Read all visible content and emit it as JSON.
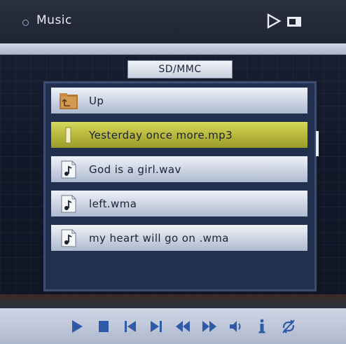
{
  "header": {
    "title": "Music"
  },
  "source": {
    "label": "SD/MMC"
  },
  "files": [
    {
      "name": "Up",
      "kind": "folder",
      "selected": false
    },
    {
      "name": "Yesterday once more.mp3",
      "kind": "audio",
      "selected": true
    },
    {
      "name": "God is a girl.wav",
      "kind": "audio",
      "selected": false
    },
    {
      "name": "left.wma",
      "kind": "audio",
      "selected": false
    },
    {
      "name": "my heart will go on .wma",
      "kind": "audio",
      "selected": false
    }
  ],
  "controls": [
    "play-icon",
    "stop-icon",
    "previous-track-icon",
    "next-track-icon",
    "rewind-icon",
    "fast-forward-icon",
    "volume-icon",
    "info-icon",
    "repeat-off-icon"
  ],
  "colors": {
    "accent": "#2f5aa8",
    "selected_row": "#c3c64a"
  }
}
